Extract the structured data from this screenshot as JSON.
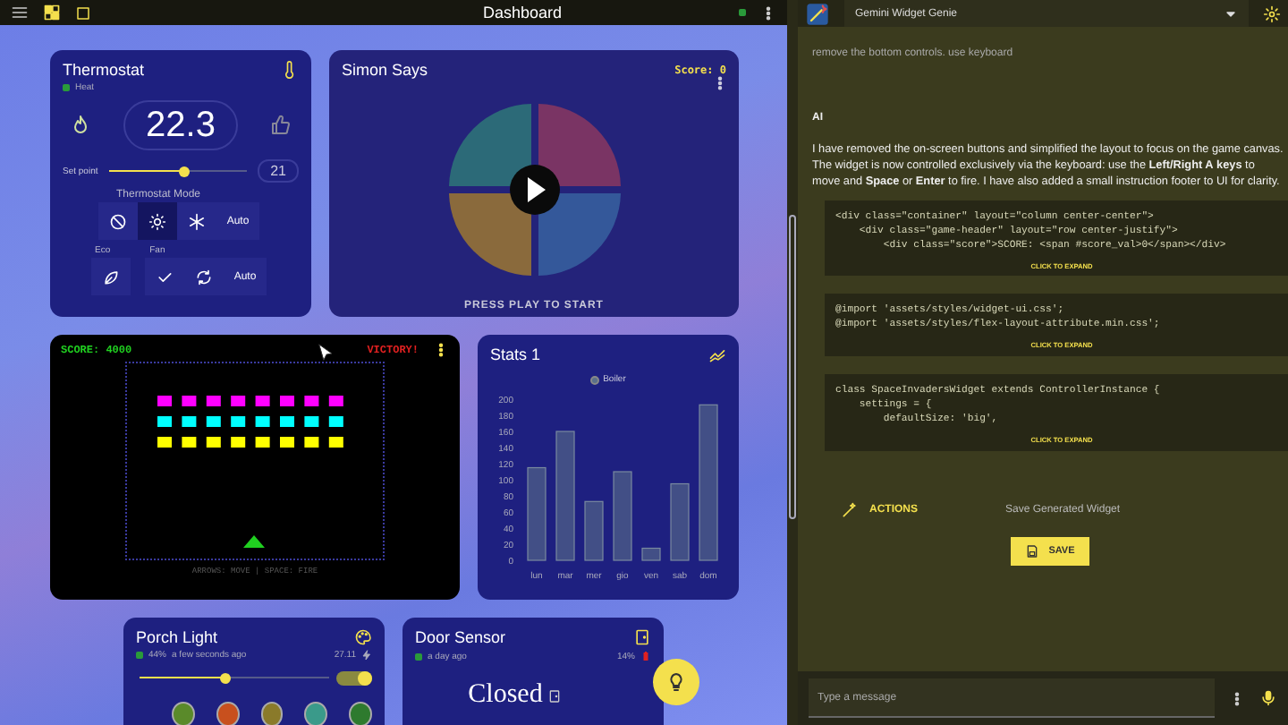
{
  "top_bar": {
    "title": "Dashboard"
  },
  "thermostat": {
    "title": "Thermostat",
    "status": "Heat",
    "temperature": "22.3",
    "setpoint_label": "Set point",
    "setpoint": {
      "level": 0.55
    },
    "setpoint_value": "21",
    "mode_title": "Thermostat Mode",
    "modes": [
      {
        "kind": "icon",
        "selected": false
      },
      {
        "kind": "icon",
        "selected": true
      },
      {
        "kind": "icon",
        "selected": false
      },
      {
        "kind": "text",
        "label": "Auto",
        "selected": false
      }
    ],
    "eco_label": "Eco",
    "fan_label": "Fan",
    "fan_modes": [
      {
        "kind": "icon",
        "selected": false
      },
      {
        "kind": "icon",
        "selected": false
      },
      {
        "kind": "text",
        "label": "Auto",
        "selected": false
      }
    ]
  },
  "simon": {
    "title": "Simon Says",
    "score": "Score: 0",
    "prompt": "PRESS PLAY TO START"
  },
  "invaders": {
    "score": "SCORE: 4000",
    "status": "VICTORY!",
    "footer": "ARROWS: MOVE | SPACE: FIRE"
  },
  "stats": {
    "title": "Stats 1",
    "chart_data": {
      "type": "bar",
      "categories": [
        "lun",
        "mar",
        "mer",
        "gio",
        "ven",
        "sab",
        "dom"
      ],
      "series": [
        {
          "name": "Boiler",
          "color": "#5a6f8a",
          "values": [
            115,
            160,
            73,
            110,
            15,
            95,
            193
          ]
        }
      ],
      "ylim": [
        0,
        200
      ],
      "yticks": [
        0,
        20,
        40,
        60,
        80,
        100,
        120,
        140,
        160,
        180,
        200
      ]
    }
  },
  "porch_light": {
    "title": "Porch Light",
    "brightness": "44%",
    "updated": "a few seconds ago",
    "power": "27.11",
    "slider": {
      "level": 0.45
    },
    "on": true,
    "swatches": [
      {
        "color": "#5a8a2a"
      },
      {
        "color": "#c8501e"
      },
      {
        "color": "#8a7a2a"
      },
      {
        "color": "#3a9a8a"
      },
      {
        "color": "#2e7a2e"
      }
    ]
  },
  "door_sensor": {
    "title": "Door Sensor",
    "updated": "a day ago",
    "battery": "14%",
    "state": "Closed"
  },
  "chat": {
    "widget_select": "Gemini Widget Genie",
    "user_message": "remove the bottom controls. use keyboard",
    "ai_label": "AI",
    "ai_message": "I have removed the on-screen buttons and simplified the layout to focus on the game canvas. The widget is now controlled exclusively via the keyboard: use the **Left/Right A** **keys** to move and **Space** or **Enter** to fire. I have also added a small instruction footer to UI for clarity.",
    "code_blocks": [
      {
        "lines": [
          "<div class=\"container\" layout=\"column center-center\">",
          "    <div class=\"game-header\" layout=\"row center-justify\">",
          "        <div class=\"score\">SCORE: <span #score_val>0</span></div>"
        ],
        "expand": "CLICK TO EXPAND"
      },
      {
        "lines": [
          "@import 'assets/styles/widget-ui.css';",
          "@import 'assets/styles/flex-layout-attribute.min.css';"
        ],
        "expand": "CLICK TO EXPAND"
      },
      {
        "lines": [
          "class SpaceInvadersWidget extends ControllerInstance {",
          "    settings = {",
          "        defaultSize: 'big',"
        ],
        "expand": "CLICK TO EXPAND"
      }
    ],
    "actions_label": "ACTIONS",
    "action": "Save Generated Widget",
    "save_button": "SAVE",
    "input_placeholder": "Type a message"
  }
}
